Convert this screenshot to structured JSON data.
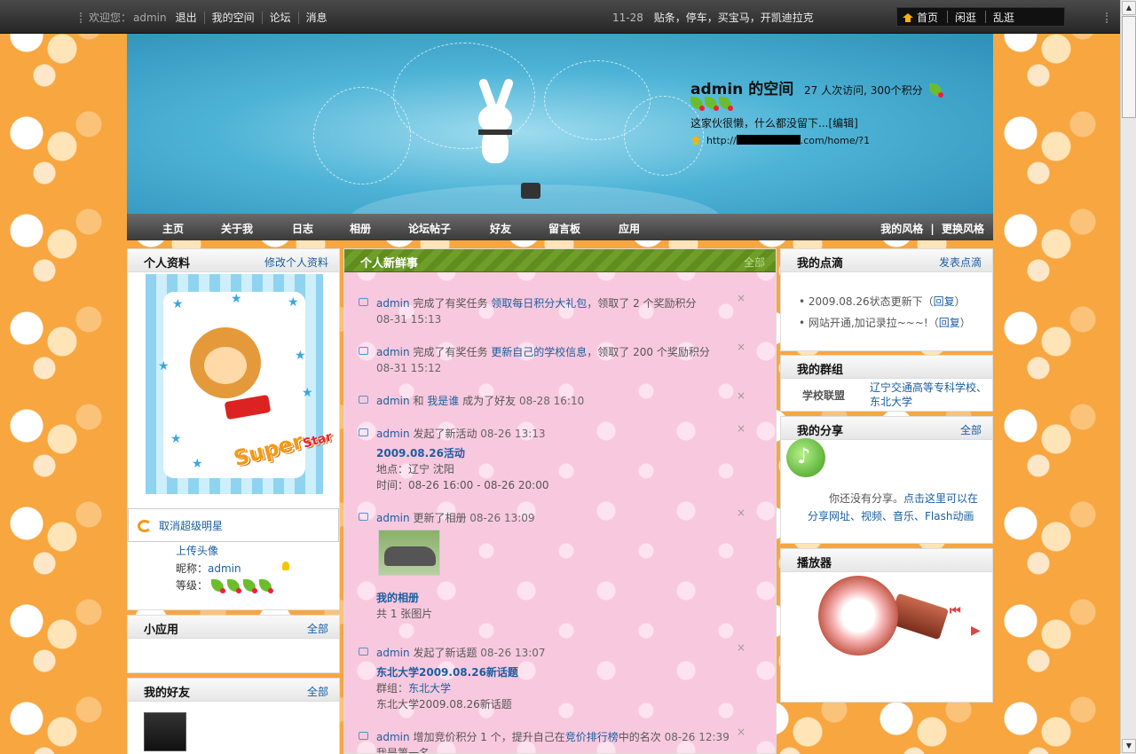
{
  "topbar": {
    "greeting": "欢迎您：",
    "username": "admin",
    "logout": "退出",
    "my_space": "我的空间",
    "forum": "论坛",
    "messages": "消息",
    "news_date": "11-28",
    "news_text": "贴条，停车，买宝马，开凯迪拉克",
    "right_links": [
      "首页",
      "闲逛",
      "乱逛"
    ]
  },
  "banner": {
    "space_title": "admin 的空间",
    "visits": "27 人次访问, 300个积分",
    "motto": "这家伙很懒，什么都没留下...",
    "edit": "[编辑]",
    "url_prefix": "http://",
    "url_suffix": ".com/home/?1"
  },
  "nav": {
    "items": [
      "主页",
      "关于我",
      "日志",
      "相册",
      "论坛帖子",
      "好友",
      "留言板",
      "应用"
    ],
    "my_style": "我的风格",
    "change_style": "更换风格"
  },
  "left": {
    "profile_title": "个人资料",
    "edit_profile": "修改个人资料",
    "superstar_text": "Super",
    "superstar_sub": "Star",
    "cancel_superstar": "取消超级明星",
    "upload_avatar": "上传头像",
    "nickname_label": "昵称：",
    "nickname": "admin",
    "level_label": "等级：",
    "apps_title": "小应用",
    "apps_more": "全部",
    "friends_title": "我的好友",
    "friends_more": "全部"
  },
  "center": {
    "title": "个人新鲜事",
    "more": "全部",
    "feeds": [
      {
        "user": "admin",
        "pre": "完成了有奖任务",
        "link": "领取每日积分大礼包",
        "post": "，领取了 2 个奖励积分",
        "time": "08-31 15:13"
      },
      {
        "user": "admin",
        "pre": "完成了有奖任务",
        "link": "更新自己的学校信息",
        "post": "，领取了 200 个奖励积分",
        "time": "08-31 15:12"
      },
      {
        "user": "admin",
        "pre": "和",
        "link": "我是谁",
        "post": "成为了好友",
        "time": "08-28 16:10"
      },
      {
        "user": "admin",
        "pre": "发起了新活动",
        "time": "08-26 13:13",
        "title": "2009.08.26活动",
        "place": "地点：辽宁 沈阳",
        "period": "时间：08-26 16:00 - 08-26 20:00"
      },
      {
        "user": "admin",
        "pre": "更新了相册",
        "time": "08-26 13:09",
        "album": "我的相册",
        "count": "共 1 张图片"
      },
      {
        "user": "admin",
        "pre": "发起了新话题",
        "time": "08-26 13:07",
        "title": "东北大学2009.08.26新话题",
        "group_label": "群组：",
        "group": "东北大学",
        "desc": "东北大学2009.08.26新话题"
      },
      {
        "user": "admin",
        "pre": "增加竞价积分 1 个，提升自己在",
        "link": "竞价排行榜",
        "post": "中的名次",
        "time": "08-26 12:39",
        "sub": "我是第一名"
      }
    ],
    "close_glyph": "×"
  },
  "right": {
    "notes_title": "我的点滴",
    "notes_more": "发表点滴",
    "notes": [
      {
        "text": "2009.08.26状态更新下",
        "reply": "回复"
      },
      {
        "text": "网站开通,加记录拉~~~!",
        "reply": "回复"
      }
    ],
    "groups_title": "我的群组",
    "group_label": "学校联盟",
    "group_links": "辽宁交通高等专科学校、东北大学",
    "share_title": "我的分享",
    "share_more": "全部",
    "share_text": "你还没有分享。",
    "share_link": "点击这里可以在分享网址、视频、音乐、Flash动画",
    "player_title": "播放器"
  },
  "colors": {
    "link": "#1a5ea0",
    "center_bg": "#f8c9de",
    "header_green": "#5f8e1e"
  }
}
